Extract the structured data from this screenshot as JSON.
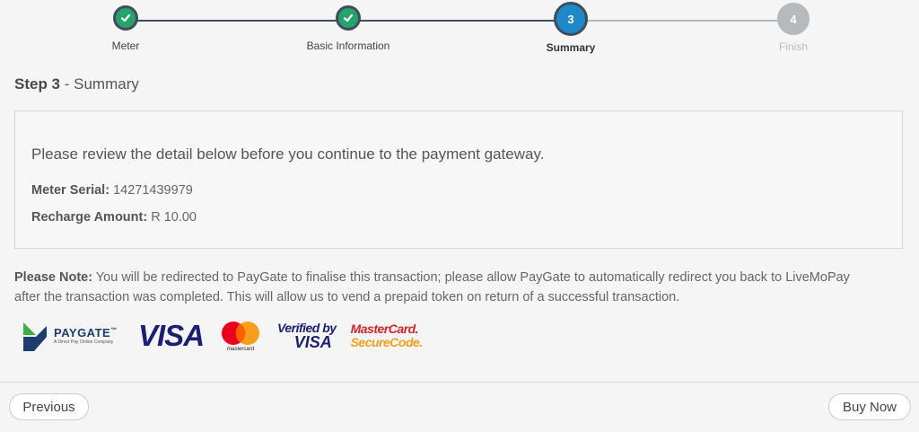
{
  "stepper": {
    "steps": [
      {
        "number": "1",
        "label": "Meter",
        "status": "done"
      },
      {
        "number": "2",
        "label": "Basic Information",
        "status": "done"
      },
      {
        "number": "3",
        "label": "Summary",
        "status": "active"
      },
      {
        "number": "4",
        "label": "Finish",
        "status": "pending"
      }
    ]
  },
  "heading": {
    "step": "Step 3",
    "separator": " - ",
    "title": "Summary"
  },
  "summary": {
    "intro": "Please review the detail below before you continue to the payment gateway.",
    "meter_serial_label": "Meter Serial:",
    "meter_serial_value": "14271439979",
    "recharge_amount_label": "Recharge Amount:",
    "recharge_amount_value": "R 10.00"
  },
  "note": {
    "label": "Please Note:",
    "text": "You will be redirected to PayGate to finalise this transaction; please allow PayGate to automatically redirect you back to LiveMoPay after the transaction was completed. This will allow us to vend a prepaid token on return of a successful transaction."
  },
  "logos": {
    "paygate": "PAYGATE",
    "paygate_tm": "™",
    "paygate_tagline": "A Direct Pay Online Company",
    "visa": "VISA",
    "mastercard": "mastercard",
    "verified_by": "Verified by",
    "verified_visa": "VISA",
    "securecode_top": "MasterCard.",
    "securecode_bottom": "SecureCode."
  },
  "footer": {
    "previous_label": "Previous",
    "buy_label": "Buy Now"
  },
  "colors": {
    "done": "#26a36b",
    "active": "#1e88c9",
    "pending": "#b7babd",
    "track": "#3d4d5c"
  }
}
